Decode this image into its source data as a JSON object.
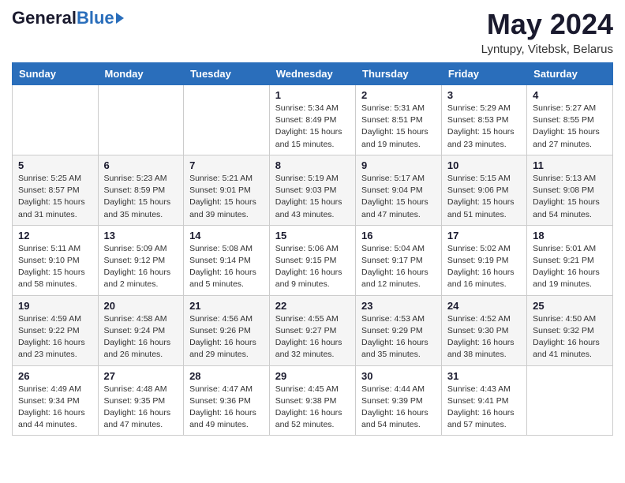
{
  "logo": {
    "general": "General",
    "blue": "Blue"
  },
  "header": {
    "title": "May 2024",
    "subtitle": "Lyntupy, Vitebsk, Belarus"
  },
  "weekdays": [
    "Sunday",
    "Monday",
    "Tuesday",
    "Wednesday",
    "Thursday",
    "Friday",
    "Saturday"
  ],
  "weeks": [
    [
      {
        "day": "",
        "info": ""
      },
      {
        "day": "",
        "info": ""
      },
      {
        "day": "",
        "info": ""
      },
      {
        "day": "1",
        "info": "Sunrise: 5:34 AM\nSunset: 8:49 PM\nDaylight: 15 hours\nand 15 minutes."
      },
      {
        "day": "2",
        "info": "Sunrise: 5:31 AM\nSunset: 8:51 PM\nDaylight: 15 hours\nand 19 minutes."
      },
      {
        "day": "3",
        "info": "Sunrise: 5:29 AM\nSunset: 8:53 PM\nDaylight: 15 hours\nand 23 minutes."
      },
      {
        "day": "4",
        "info": "Sunrise: 5:27 AM\nSunset: 8:55 PM\nDaylight: 15 hours\nand 27 minutes."
      }
    ],
    [
      {
        "day": "5",
        "info": "Sunrise: 5:25 AM\nSunset: 8:57 PM\nDaylight: 15 hours\nand 31 minutes."
      },
      {
        "day": "6",
        "info": "Sunrise: 5:23 AM\nSunset: 8:59 PM\nDaylight: 15 hours\nand 35 minutes."
      },
      {
        "day": "7",
        "info": "Sunrise: 5:21 AM\nSunset: 9:01 PM\nDaylight: 15 hours\nand 39 minutes."
      },
      {
        "day": "8",
        "info": "Sunrise: 5:19 AM\nSunset: 9:03 PM\nDaylight: 15 hours\nand 43 minutes."
      },
      {
        "day": "9",
        "info": "Sunrise: 5:17 AM\nSunset: 9:04 PM\nDaylight: 15 hours\nand 47 minutes."
      },
      {
        "day": "10",
        "info": "Sunrise: 5:15 AM\nSunset: 9:06 PM\nDaylight: 15 hours\nand 51 minutes."
      },
      {
        "day": "11",
        "info": "Sunrise: 5:13 AM\nSunset: 9:08 PM\nDaylight: 15 hours\nand 54 minutes."
      }
    ],
    [
      {
        "day": "12",
        "info": "Sunrise: 5:11 AM\nSunset: 9:10 PM\nDaylight: 15 hours\nand 58 minutes."
      },
      {
        "day": "13",
        "info": "Sunrise: 5:09 AM\nSunset: 9:12 PM\nDaylight: 16 hours\nand 2 minutes."
      },
      {
        "day": "14",
        "info": "Sunrise: 5:08 AM\nSunset: 9:14 PM\nDaylight: 16 hours\nand 5 minutes."
      },
      {
        "day": "15",
        "info": "Sunrise: 5:06 AM\nSunset: 9:15 PM\nDaylight: 16 hours\nand 9 minutes."
      },
      {
        "day": "16",
        "info": "Sunrise: 5:04 AM\nSunset: 9:17 PM\nDaylight: 16 hours\nand 12 minutes."
      },
      {
        "day": "17",
        "info": "Sunrise: 5:02 AM\nSunset: 9:19 PM\nDaylight: 16 hours\nand 16 minutes."
      },
      {
        "day": "18",
        "info": "Sunrise: 5:01 AM\nSunset: 9:21 PM\nDaylight: 16 hours\nand 19 minutes."
      }
    ],
    [
      {
        "day": "19",
        "info": "Sunrise: 4:59 AM\nSunset: 9:22 PM\nDaylight: 16 hours\nand 23 minutes."
      },
      {
        "day": "20",
        "info": "Sunrise: 4:58 AM\nSunset: 9:24 PM\nDaylight: 16 hours\nand 26 minutes."
      },
      {
        "day": "21",
        "info": "Sunrise: 4:56 AM\nSunset: 9:26 PM\nDaylight: 16 hours\nand 29 minutes."
      },
      {
        "day": "22",
        "info": "Sunrise: 4:55 AM\nSunset: 9:27 PM\nDaylight: 16 hours\nand 32 minutes."
      },
      {
        "day": "23",
        "info": "Sunrise: 4:53 AM\nSunset: 9:29 PM\nDaylight: 16 hours\nand 35 minutes."
      },
      {
        "day": "24",
        "info": "Sunrise: 4:52 AM\nSunset: 9:30 PM\nDaylight: 16 hours\nand 38 minutes."
      },
      {
        "day": "25",
        "info": "Sunrise: 4:50 AM\nSunset: 9:32 PM\nDaylight: 16 hours\nand 41 minutes."
      }
    ],
    [
      {
        "day": "26",
        "info": "Sunrise: 4:49 AM\nSunset: 9:34 PM\nDaylight: 16 hours\nand 44 minutes."
      },
      {
        "day": "27",
        "info": "Sunrise: 4:48 AM\nSunset: 9:35 PM\nDaylight: 16 hours\nand 47 minutes."
      },
      {
        "day": "28",
        "info": "Sunrise: 4:47 AM\nSunset: 9:36 PM\nDaylight: 16 hours\nand 49 minutes."
      },
      {
        "day": "29",
        "info": "Sunrise: 4:45 AM\nSunset: 9:38 PM\nDaylight: 16 hours\nand 52 minutes."
      },
      {
        "day": "30",
        "info": "Sunrise: 4:44 AM\nSunset: 9:39 PM\nDaylight: 16 hours\nand 54 minutes."
      },
      {
        "day": "31",
        "info": "Sunrise: 4:43 AM\nSunset: 9:41 PM\nDaylight: 16 hours\nand 57 minutes."
      },
      {
        "day": "",
        "info": ""
      }
    ]
  ]
}
